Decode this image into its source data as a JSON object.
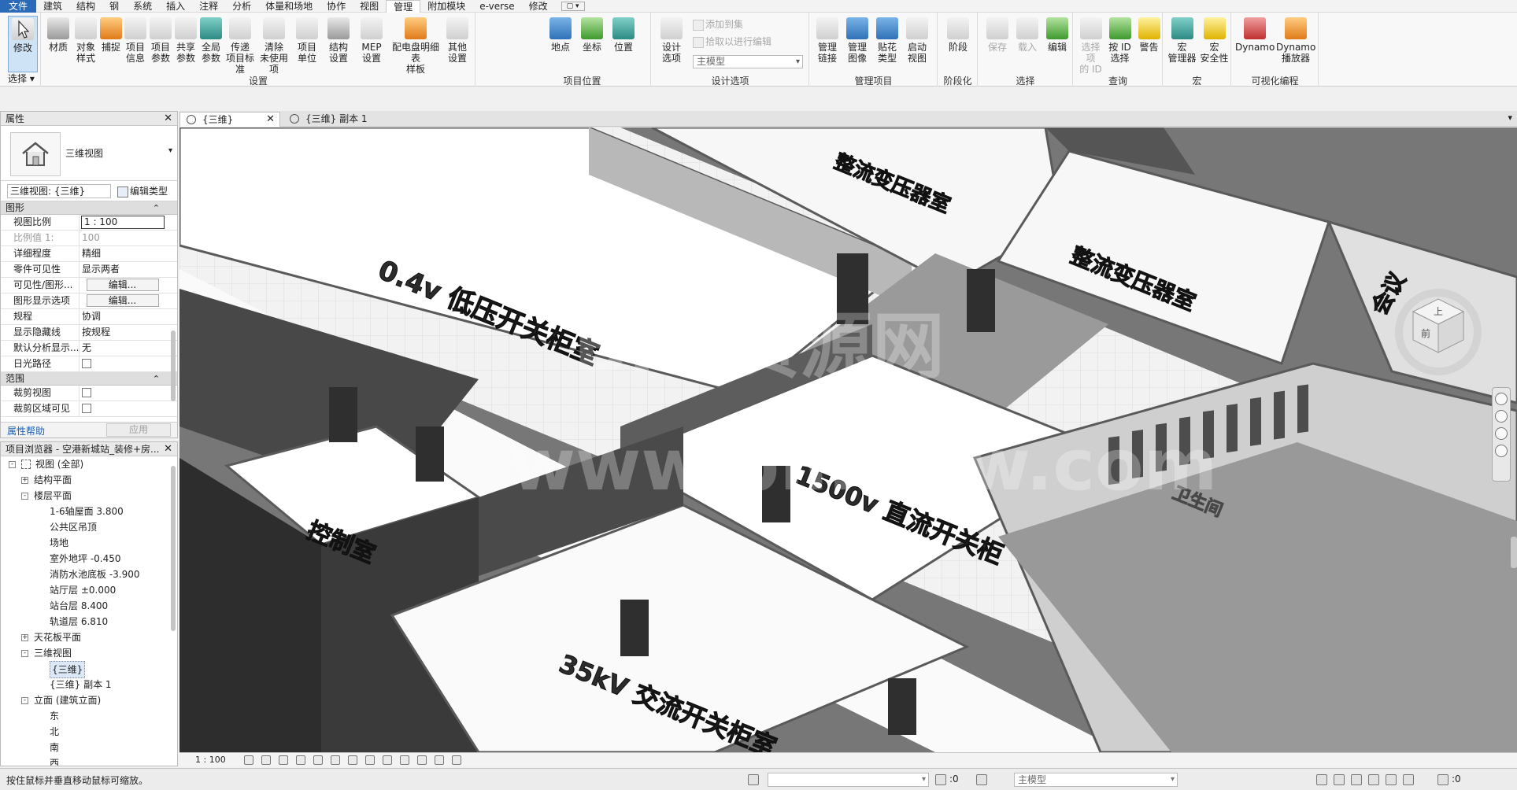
{
  "menubar": {
    "items": [
      "文件",
      "建筑",
      "结构",
      "钢",
      "系统",
      "插入",
      "注释",
      "分析",
      "体量和场地",
      "协作",
      "视图",
      "管理",
      "附加模块",
      "e-verse",
      "修改"
    ],
    "active": "管理",
    "qat": "▢ ▾"
  },
  "ribbon": {
    "select": {
      "title": "选择",
      "modify": "修改",
      "dropdown": "选择 ▾"
    },
    "settings": {
      "title": "设置",
      "buttons": [
        "材质",
        "对象\n样式",
        "捕捉",
        "项目\n信息",
        "项目\n参数",
        "共享\n参数",
        "全局\n参数",
        "传递\n项目标准",
        "清除\n未使用项",
        "项目\n单位",
        "结构\n设置",
        "MEP\n设置",
        "配电盘明细表\n样板",
        "其他\n设置"
      ]
    },
    "location": {
      "title": "项目位置",
      "buttons": [
        "地点",
        "坐标",
        "位置"
      ]
    },
    "design_options": {
      "title": "设计选项",
      "button": "设计\n选项",
      "add_to_set": "添加到集",
      "pick_to_edit": "拾取以进行编辑",
      "main_model": "主模型"
    },
    "manage_project": {
      "title": "管理项目",
      "buttons": [
        "管理\n链接",
        "管理\n图像",
        "贴花\n类型",
        "启动\n视图"
      ]
    },
    "phasing": {
      "title": "阶段化",
      "buttons": [
        "阶段"
      ]
    },
    "selection": {
      "title": "选择",
      "buttons": [
        "保存",
        "载入",
        "编辑"
      ]
    },
    "inquiry": {
      "title": "查询",
      "buttons": [
        "选择项\n的 ID",
        "按 ID\n选择",
        "警告"
      ]
    },
    "macros": {
      "title": "宏",
      "buttons": [
        "宏\n管理器",
        "宏\n安全性"
      ]
    },
    "visual_programming": {
      "title": "可视化编程",
      "buttons": [
        "Dynamo",
        "Dynamo\n播放器"
      ]
    }
  },
  "properties": {
    "title": "属性",
    "type_name": "三维视图",
    "instance_selector": "三维视图: {三维}",
    "edit_type": "编辑类型",
    "groups": [
      {
        "name": "图形",
        "rows": [
          {
            "k": "视图比例",
            "v": "1 : 100",
            "style": "edit"
          },
          {
            "k": "比例值 1:",
            "v": "100",
            "style": "disabled"
          },
          {
            "k": "详细程度",
            "v": "精细",
            "style": ""
          },
          {
            "k": "零件可见性",
            "v": "显示两者",
            "style": ""
          },
          {
            "k": "可见性/图形...",
            "v": "编辑...",
            "style": "btn"
          },
          {
            "k": "图形显示选项",
            "v": "编辑...",
            "style": "btn"
          },
          {
            "k": "规程",
            "v": "协调",
            "style": ""
          },
          {
            "k": "显示隐藏线",
            "v": "按规程",
            "style": ""
          },
          {
            "k": "默认分析显示...",
            "v": "无",
            "style": ""
          },
          {
            "k": "日光路径",
            "v": "",
            "style": "check"
          }
        ]
      },
      {
        "name": "范围",
        "rows": [
          {
            "k": "裁剪视图",
            "v": "",
            "style": "check"
          },
          {
            "k": "裁剪区域可见",
            "v": "",
            "style": "check"
          }
        ]
      }
    ],
    "help": "属性帮助",
    "apply": "应用"
  },
  "browser": {
    "title": "项目浏览器 - 空港新城站_装修+房...",
    "items": [
      {
        "label": "视图 (全部)",
        "level": 0,
        "toggle": "-",
        "icon": true
      },
      {
        "label": "结构平面",
        "level": 1,
        "toggle": "+"
      },
      {
        "label": "楼层平面",
        "level": 1,
        "toggle": "-"
      },
      {
        "label": "1-6轴屋面 3.800",
        "level": 2
      },
      {
        "label": "公共区吊顶",
        "level": 2
      },
      {
        "label": "场地",
        "level": 2
      },
      {
        "label": "室外地坪 -0.450",
        "level": 2
      },
      {
        "label": "消防水池底板 -3.900",
        "level": 2
      },
      {
        "label": "站厅层 ±0.000",
        "level": 2
      },
      {
        "label": "站台层 8.400",
        "level": 2
      },
      {
        "label": "轨道层 6.810",
        "level": 2
      },
      {
        "label": "天花板平面",
        "level": 1,
        "toggle": "+"
      },
      {
        "label": "三维视图",
        "level": 1,
        "toggle": "-"
      },
      {
        "label": "{三维}",
        "level": 2,
        "selected": true
      },
      {
        "label": "{三维} 副本 1",
        "level": 2
      },
      {
        "label": "立面 (建筑立面)",
        "level": 1,
        "toggle": "-"
      },
      {
        "label": "东",
        "level": 2
      },
      {
        "label": "北",
        "level": 2
      },
      {
        "label": "南",
        "level": 2
      },
      {
        "label": "西",
        "level": 2
      }
    ]
  },
  "tabs": [
    {
      "label": "{三维}",
      "active": true
    },
    {
      "label": "{三维} 副本 1",
      "active": false
    }
  ],
  "viewport": {
    "room_labels": [
      "0.4v 低压开关柜室",
      "整流变压器室",
      "整流变压器室",
      "会议",
      "1500v 直流开关柜",
      "控制室",
      "35kV 交流开关柜室",
      "卫生间"
    ],
    "watermark_1": "BIM资源网",
    "watermark_2": "www.bimzyw.com",
    "viewcube": {
      "top": "上",
      "front": "前"
    }
  },
  "view_control": {
    "scale": "1 : 100"
  },
  "status": {
    "hint": "按住鼠标并垂直移动鼠标可缩放。",
    "count_1": ":0",
    "model": "主模型",
    "filter_count": ":0"
  }
}
